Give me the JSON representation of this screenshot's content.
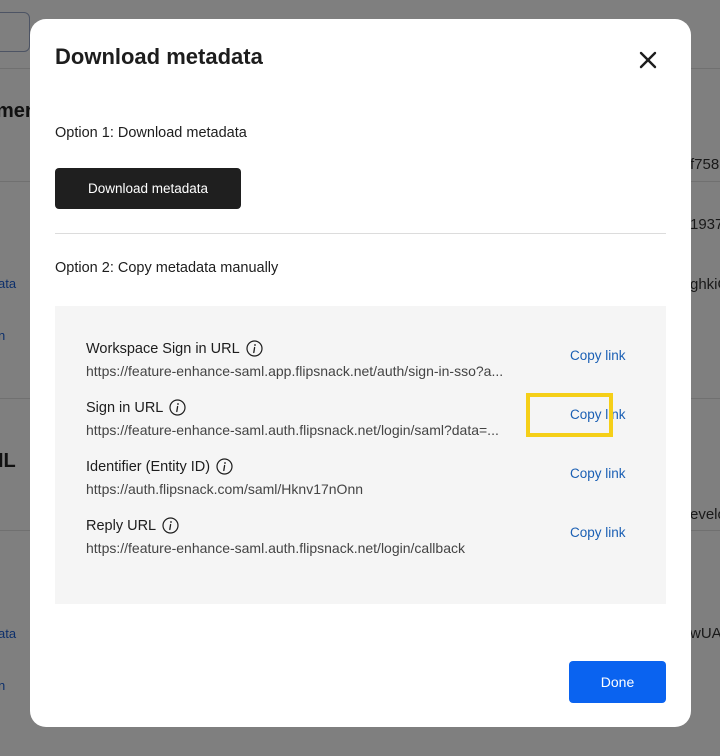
{
  "background": {
    "fragments": {
      "heading_1": "ment",
      "heading_2": "IL",
      "link_1": "ata",
      "link_2": "n",
      "link_3": "ata",
      "link_4": "n",
      "right_1": "f758",
      "right_2": "1937",
      "right_3": "ghkiG",
      "right_4": "evelo",
      "right_5": "wUA"
    }
  },
  "modal": {
    "title": "Download metadata",
    "close_icon": "close-icon",
    "option1_label": "Option 1: Download metadata",
    "download_button_label": "Download metadata",
    "option2_label": "Option 2: Copy metadata manually",
    "rows": [
      {
        "label": "Workspace Sign in URL",
        "url": "https://feature-enhance-saml.app.flipsnack.net/auth/sign-in-sso?a...",
        "copy_label": "Copy link"
      },
      {
        "label": "Sign in URL",
        "url": "https://feature-enhance-saml.auth.flipsnack.net/login/saml?data=...",
        "copy_label": "Copy link"
      },
      {
        "label": "Identifier (Entity ID)",
        "url": "https://auth.flipsnack.com/saml/Hknv17nOnn",
        "copy_label": "Copy link"
      },
      {
        "label": "Reply URL",
        "url": "https://feature-enhance-saml.auth.flipsnack.net/login/callback",
        "copy_label": "Copy link"
      }
    ],
    "done_button_label": "Done"
  },
  "colors": {
    "primary_button": "#0a63f0",
    "dark_button": "#1f1f1f",
    "link": "#1a5fb4",
    "highlight": "#f5cf18",
    "panel_background": "#f5f5f5"
  }
}
